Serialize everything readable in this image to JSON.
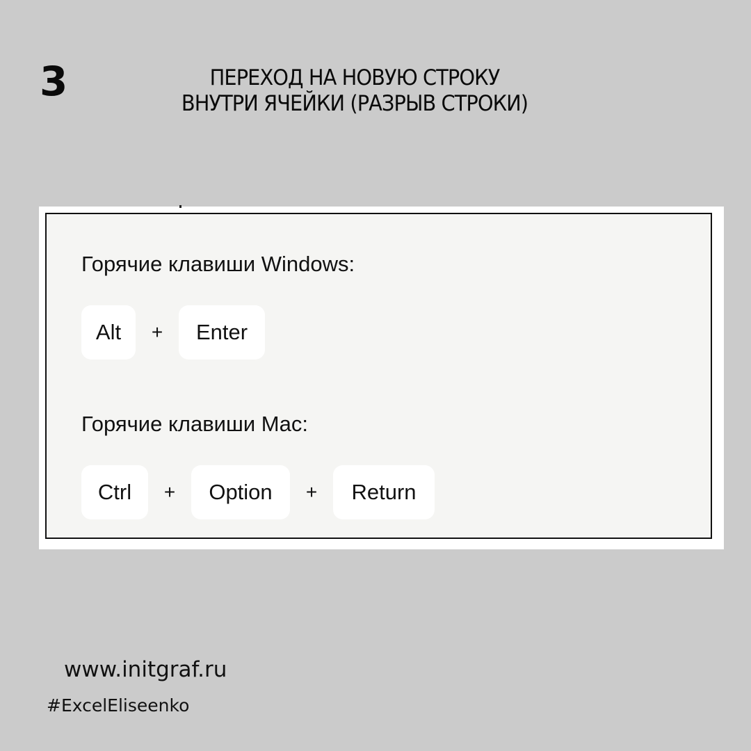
{
  "step_number": "3",
  "title": {
    "line1": "ПЕРЕХОД НА НОВУЮ СТРОКУ",
    "line2": "ВНУТРИ ЯЧЕЙКИ (РАЗРЫВ СТРОКИ)"
  },
  "windows": {
    "heading": "Горячие клавиши Windows:",
    "keys": [
      "Alt",
      "Enter"
    ],
    "separator": "+"
  },
  "mac": {
    "heading": "Горячие клавиши Mac:",
    "keys": [
      "Ctrl",
      "Option",
      "Return"
    ],
    "separator": "+"
  },
  "footer": {
    "website": "www.initgraf.ru",
    "hashtag": "#ExcelEliseenko"
  },
  "colors": {
    "background": "#cbcbcb",
    "panel": "#f5f5f3",
    "key": "#ffffff",
    "text": "#111111"
  }
}
